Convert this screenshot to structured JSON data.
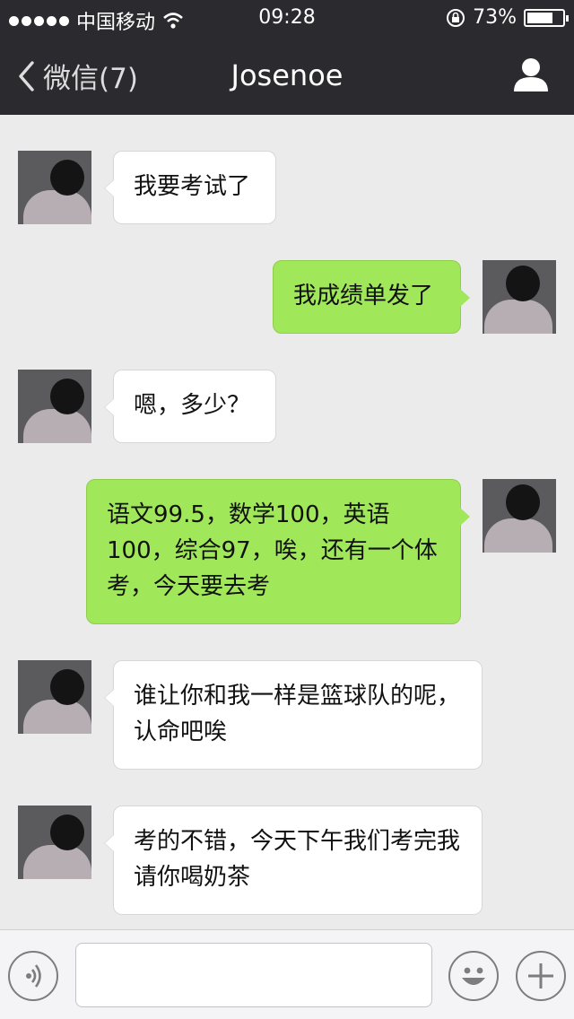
{
  "status_bar": {
    "carrier": "中国移动",
    "time": "09:28",
    "battery_percent": "73%",
    "battery_level": 0.73,
    "icons": [
      "signal-dots-icon",
      "wifi-icon",
      "rotation-lock-icon",
      "battery-icon"
    ]
  },
  "nav": {
    "back_label": "微信(7)",
    "title": "Josenoe",
    "profile_icon": "person-icon"
  },
  "messages": [
    {
      "side": "incoming",
      "text": "我要考试了"
    },
    {
      "side": "outgoing",
      "text": "我成绩单发了"
    },
    {
      "side": "incoming",
      "text": "嗯，多少？"
    },
    {
      "side": "outgoing",
      "text": "语文99.5，数学100，英语100，综合97，唉，还有一个体考，今天要去考"
    },
    {
      "side": "incoming",
      "text": "谁让你和我一样是篮球队的呢，认命吧唉"
    },
    {
      "side": "incoming",
      "text": "考的不错，今天下午我们考完我请你喝奶茶"
    }
  ],
  "input_bar": {
    "message_value": "",
    "voice_icon": "voice-icon",
    "emoji_icon": "emoji-icon",
    "plus_icon": "plus-icon"
  },
  "colors": {
    "header_bg": "#2b2a2f",
    "chat_bg": "#ebebeb",
    "outgoing_bubble": "#a0e75a",
    "incoming_bubble": "#ffffff"
  }
}
